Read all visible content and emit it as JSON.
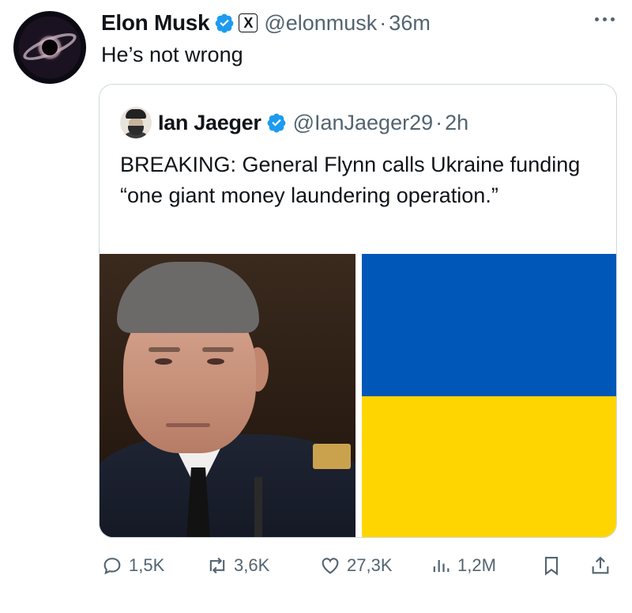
{
  "tweet": {
    "author_name": "Elon Musk",
    "author_handle": "@elonmusk",
    "separator": "·",
    "time": "36m",
    "text": "He’s not wrong",
    "x_badge": "X"
  },
  "quoted": {
    "author_name": "Ian Jaeger",
    "author_handle": "@IanJaeger29",
    "separator": "·",
    "time": "2h",
    "text": "BREAKING: General Flynn calls Ukraine funding “one giant money laundering operation.”",
    "media": {
      "left": "portrait-photo",
      "right": "ukraine-flag",
      "flag_colors": {
        "top": "#0057b7",
        "bottom": "#ffd500"
      }
    }
  },
  "actions": {
    "replies": "1,5K",
    "reposts": "3,6K",
    "likes": "27,3K",
    "views": "1,2M"
  },
  "colors": {
    "verified": "#1d9bf0",
    "muted": "#536471",
    "text": "#0f1419",
    "border": "#cfd9de"
  }
}
